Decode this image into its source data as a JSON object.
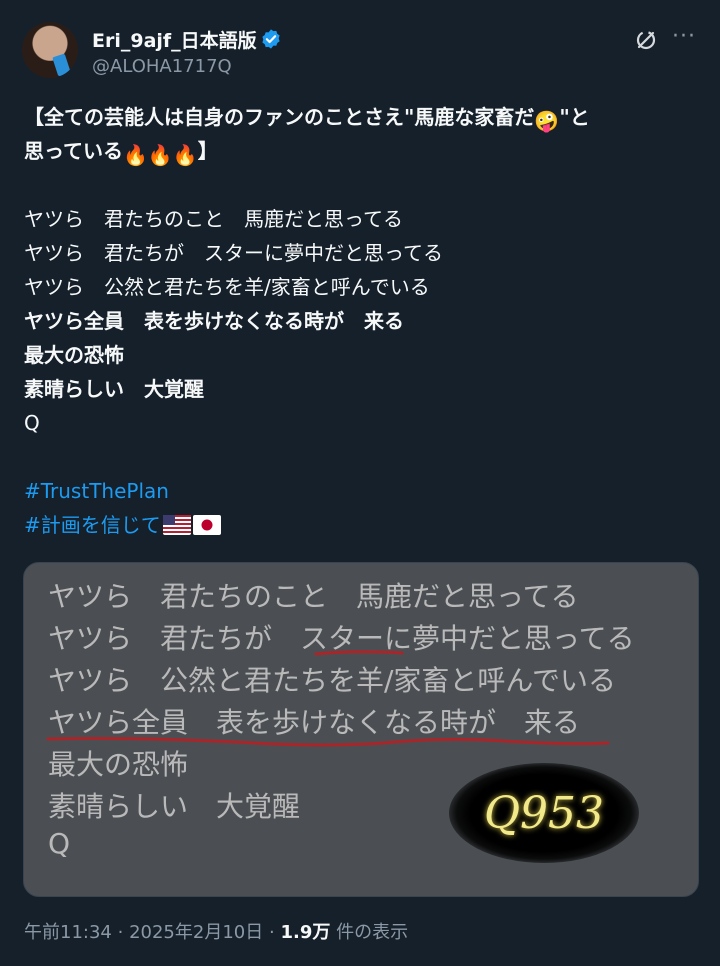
{
  "author": {
    "display_name": "Eri_9ajf_日本語版",
    "handle": "@ALOHA1717Q",
    "verified": true
  },
  "post": {
    "line1": "【全ての芸能人は自身のファンのことさえ\"馬鹿な家畜だ",
    "line1_emoji": "🤪",
    "line1_end": "\"と",
    "line2": "思っている",
    "line2_emoji": "🔥🔥🔥",
    "line2_end": "】",
    "lines": [
      "ヤツら　君たちのこと　馬鹿だと思ってる",
      "ヤツら　君たちが　スターに夢中だと思ってる",
      "ヤツら　公然と君たちを羊/家畜と呼んでいる"
    ],
    "bold_lines": [
      "ヤツら全員　表を歩けなくなる時が　来る",
      "最大の恐怖",
      "素晴らしい　大覚醒"
    ],
    "q": "Q",
    "hashtag1": "#TrustThePlan",
    "hashtag2": "#計画を信じて",
    "flags": [
      "us-flag-icon",
      "japan-flag-icon"
    ]
  },
  "media": {
    "lines": [
      "ヤツら　君たちのこと　馬鹿だと思ってる",
      "ヤツら　君たちが　スターに夢中だと思ってる",
      "ヤツら　公然と君たちを羊/家畜と呼んでいる",
      "ヤツら全員　表を歩けなくなる時が　来る",
      "最大の恐怖",
      "素晴らしい　大覚醒",
      "Q"
    ],
    "logo_text": "Q953",
    "underline_color": "#a8262a"
  },
  "meta": {
    "time": "午前11:34",
    "sep1": "·",
    "date": "2025年2月10日",
    "sep2": "·",
    "views": "1.9万",
    "views_label": " 件の表示"
  },
  "colors": {
    "background": "#15202b",
    "accent": "#1d9bf0",
    "muted": "#8b98a5"
  }
}
